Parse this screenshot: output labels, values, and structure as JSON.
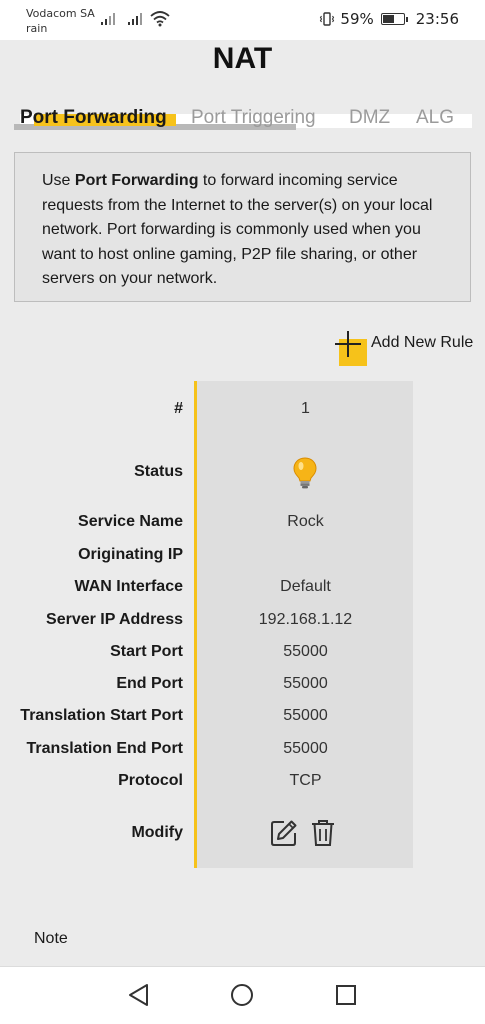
{
  "status_bar": {
    "carrier_line1": "Vodacom SA",
    "carrier_line2": "rain",
    "battery_percent": "59%",
    "battery_level": 0.59,
    "time": "23:56"
  },
  "page": {
    "title": "NAT"
  },
  "tabs": [
    {
      "label": "Port Forwarding",
      "active": true
    },
    {
      "label": "Port Triggering",
      "active": false
    },
    {
      "label": "DMZ",
      "active": false
    },
    {
      "label": "ALG",
      "active": false
    }
  ],
  "info": {
    "prefix": "Use ",
    "highlight": "Port Forwarding",
    "rest_line1": " to forward incoming service",
    "line2": "requests from the Internet to the server(s) on your local",
    "line3": "network. Port forwarding is commonly used when you",
    "line4": "want to host online gaming, P2P file sharing, or other",
    "line5": "servers on your network."
  },
  "add_rule": {
    "label": "Add New Rule"
  },
  "rule": {
    "labels": {
      "index": "#",
      "status": "Status",
      "service_name": "Service Name",
      "originating_ip": "Originating IP",
      "wan_interface": "WAN Interface",
      "server_ip": "Server IP Address",
      "start_port": "Start Port",
      "end_port": "End Port",
      "translation_start_port": "Translation Start Port",
      "translation_end_port": "Translation End Port",
      "protocol": "Protocol",
      "modify": "Modify"
    },
    "values": {
      "index": "1",
      "status_icon": "lightbulb-on-icon",
      "service_name": "Rock",
      "originating_ip": "",
      "wan_interface": "Default",
      "server_ip": "192.168.1.12",
      "start_port": "55000",
      "end_port": "55000",
      "translation_start_port": "55000",
      "translation_end_port": "55000",
      "protocol": "TCP"
    }
  },
  "note": {
    "label": "Note"
  },
  "colors": {
    "accent": "#f6c21a",
    "background": "#ebebeb",
    "panel": "#dedede"
  }
}
